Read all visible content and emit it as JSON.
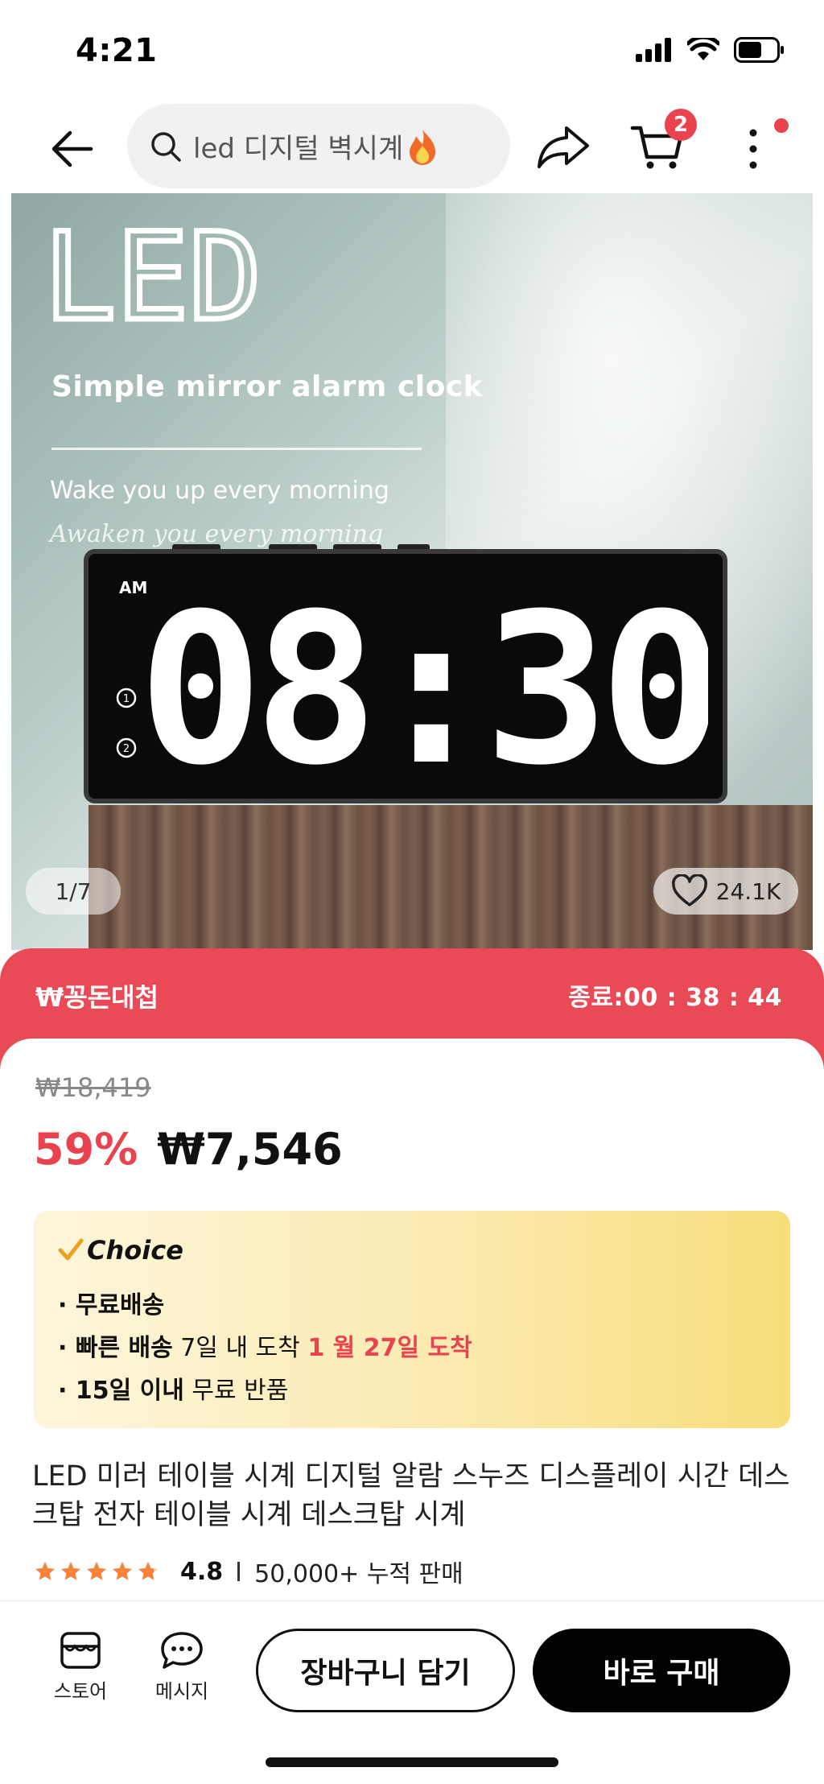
{
  "status_bar": {
    "time": "4:21"
  },
  "search": {
    "query": "led 디지털 벽시계"
  },
  "cart": {
    "badge_count": "2"
  },
  "hero": {
    "headline": "LED",
    "subtitle": "Simple mirror alarm clock",
    "tagline": "Wake you up every morning",
    "script_tagline": "Awaken you every morning",
    "clock_time": "08:30",
    "clock_am": "AM",
    "image_counter": "1/7",
    "likes": "24.1K"
  },
  "promo": {
    "title": "₩꽁돈대첩",
    "timer": "종료:00 : 38 : 44"
  },
  "pricing": {
    "original_price": "₩18,419",
    "discount": "59%",
    "sale_price": "₩7,546"
  },
  "choice": {
    "label": "Choice",
    "free_shipping": "· 무료배송",
    "fast_shipping_prefix": "· 빠른 배송",
    "fast_shipping_mid": " 7일 내 도착 ",
    "arrival_date": "1 월 27일 도착",
    "return_prefix": "· 15일 이내",
    "return_suffix": "  무료 반품"
  },
  "product": {
    "title": "LED 미러 테이블 시계 디지털 알람 스누즈 디스플레이 시간 데스크탑 전자 테이블 시계 데스크탑 시계",
    "rating": "4.8",
    "stars": 4.8,
    "sold": "50,000+ 누적 판매"
  },
  "bottom_bar": {
    "store_label": "스토어",
    "message_label": "메시지",
    "add_to_cart": "장바구니 담기",
    "buy_now": "바로 구매"
  },
  "colors": {
    "accent_red": "#e8434f",
    "promo_red": "#e94a56",
    "star_orange": "#f5833b"
  }
}
